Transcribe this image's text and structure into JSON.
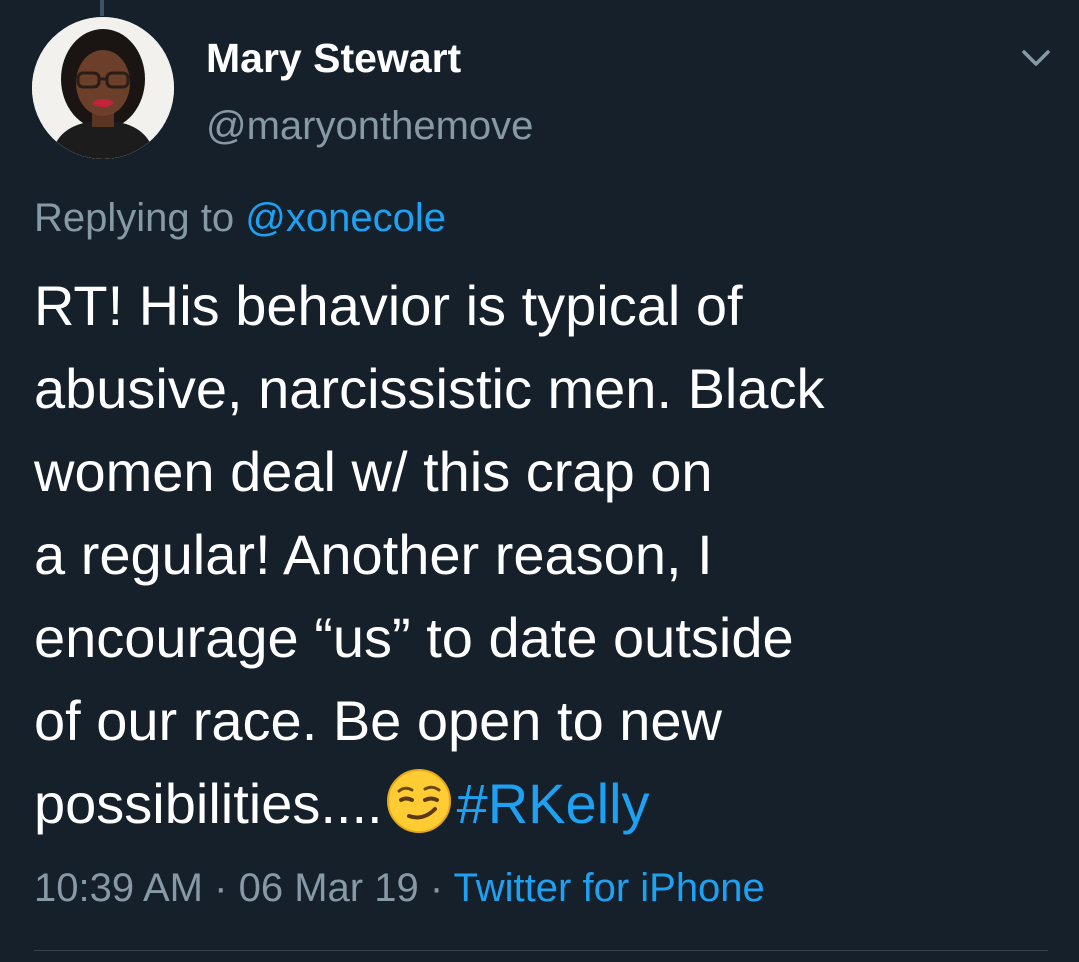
{
  "tweet": {
    "author": {
      "display_name": "Mary Stewart",
      "handle": "@maryonthemove",
      "avatar_icon": "profile-photo"
    },
    "replying_to": {
      "prefix": "Replying to",
      "mention": "@xonecole"
    },
    "body_lines": [
      "RT! His behavior is typical of",
      "abusive, narcissistic men. Black",
      "women deal w/ this crap on",
      "a regular! Another reason, I",
      "encourage “us” to date outside",
      "of our race. Be open to new",
      "possibilities...."
    ],
    "emoji": "smirking-face",
    "hashtag": "#RKelly",
    "time": "10:39 AM",
    "date": "06 Mar 19",
    "separator": "·",
    "source": "Twitter for iPhone",
    "menu_icon": "chevron-down-icon"
  },
  "colors": {
    "background": "#15202b",
    "text": "#ffffff",
    "secondary": "#8899a6",
    "accent": "#1da1f2",
    "divider": "#38444d"
  }
}
